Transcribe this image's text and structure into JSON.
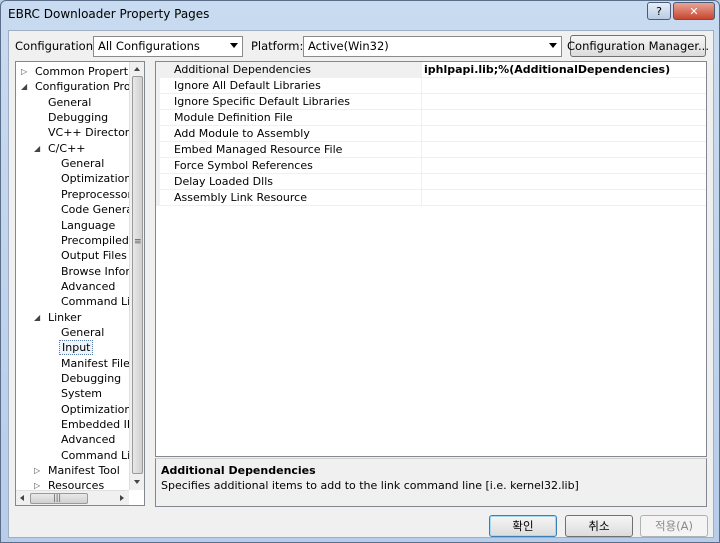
{
  "window": {
    "title": "EBRC Downloader Property Pages",
    "help_glyph": "?",
    "close_glyph": "✕"
  },
  "toolbar": {
    "configuration_label": "Configuration:",
    "configuration_value": "All Configurations",
    "platform_label": "Platform:",
    "platform_value": "Active(Win32)",
    "config_manager_label": "Configuration Manager..."
  },
  "tree": {
    "items": [
      {
        "label": "Common Properties",
        "expander": "▷"
      },
      {
        "label": "Configuration Prope",
        "expander": "◢"
      },
      {
        "label": "General"
      },
      {
        "label": "Debugging"
      },
      {
        "label": "VC++ Directories"
      },
      {
        "label": "C/C++",
        "expander": "◢"
      },
      {
        "label": "General"
      },
      {
        "label": "Optimization"
      },
      {
        "label": "Preprocessor"
      },
      {
        "label": "Code Generatio"
      },
      {
        "label": "Language"
      },
      {
        "label": "Precompiled H"
      },
      {
        "label": "Output Files"
      },
      {
        "label": "Browse Inform"
      },
      {
        "label": "Advanced"
      },
      {
        "label": "Command Line"
      },
      {
        "label": "Linker",
        "expander": "◢"
      },
      {
        "label": "General"
      },
      {
        "label": "Input",
        "selected": true
      },
      {
        "label": "Manifest File"
      },
      {
        "label": "Debugging"
      },
      {
        "label": "System"
      },
      {
        "label": "Optimization"
      },
      {
        "label": "Embedded IDL"
      },
      {
        "label": "Advanced"
      },
      {
        "label": "Command Line"
      },
      {
        "label": "Manifest Tool",
        "expander": "▷"
      },
      {
        "label": "Resources",
        "expander": "▷"
      }
    ],
    "scroll_grip_glyph": "≡",
    "hscroll_grip_glyph": "|||"
  },
  "properties": [
    {
      "name": "Additional Dependencies",
      "value": "iphlpapi.lib;%(AdditionalDependencies)"
    },
    {
      "name": "Ignore All Default Libraries",
      "value": ""
    },
    {
      "name": "Ignore Specific Default Libraries",
      "value": ""
    },
    {
      "name": "Module Definition File",
      "value": ""
    },
    {
      "name": "Add Module to Assembly",
      "value": ""
    },
    {
      "name": "Embed Managed Resource File",
      "value": ""
    },
    {
      "name": "Force Symbol References",
      "value": ""
    },
    {
      "name": "Delay Loaded Dlls",
      "value": ""
    },
    {
      "name": "Assembly Link Resource",
      "value": ""
    }
  ],
  "description": {
    "title": "Additional Dependencies",
    "text": "Specifies additional items to add to the link command line [i.e. kernel32.lib]"
  },
  "buttons": {
    "ok": "확인",
    "cancel": "취소",
    "apply": "적용(A)"
  }
}
